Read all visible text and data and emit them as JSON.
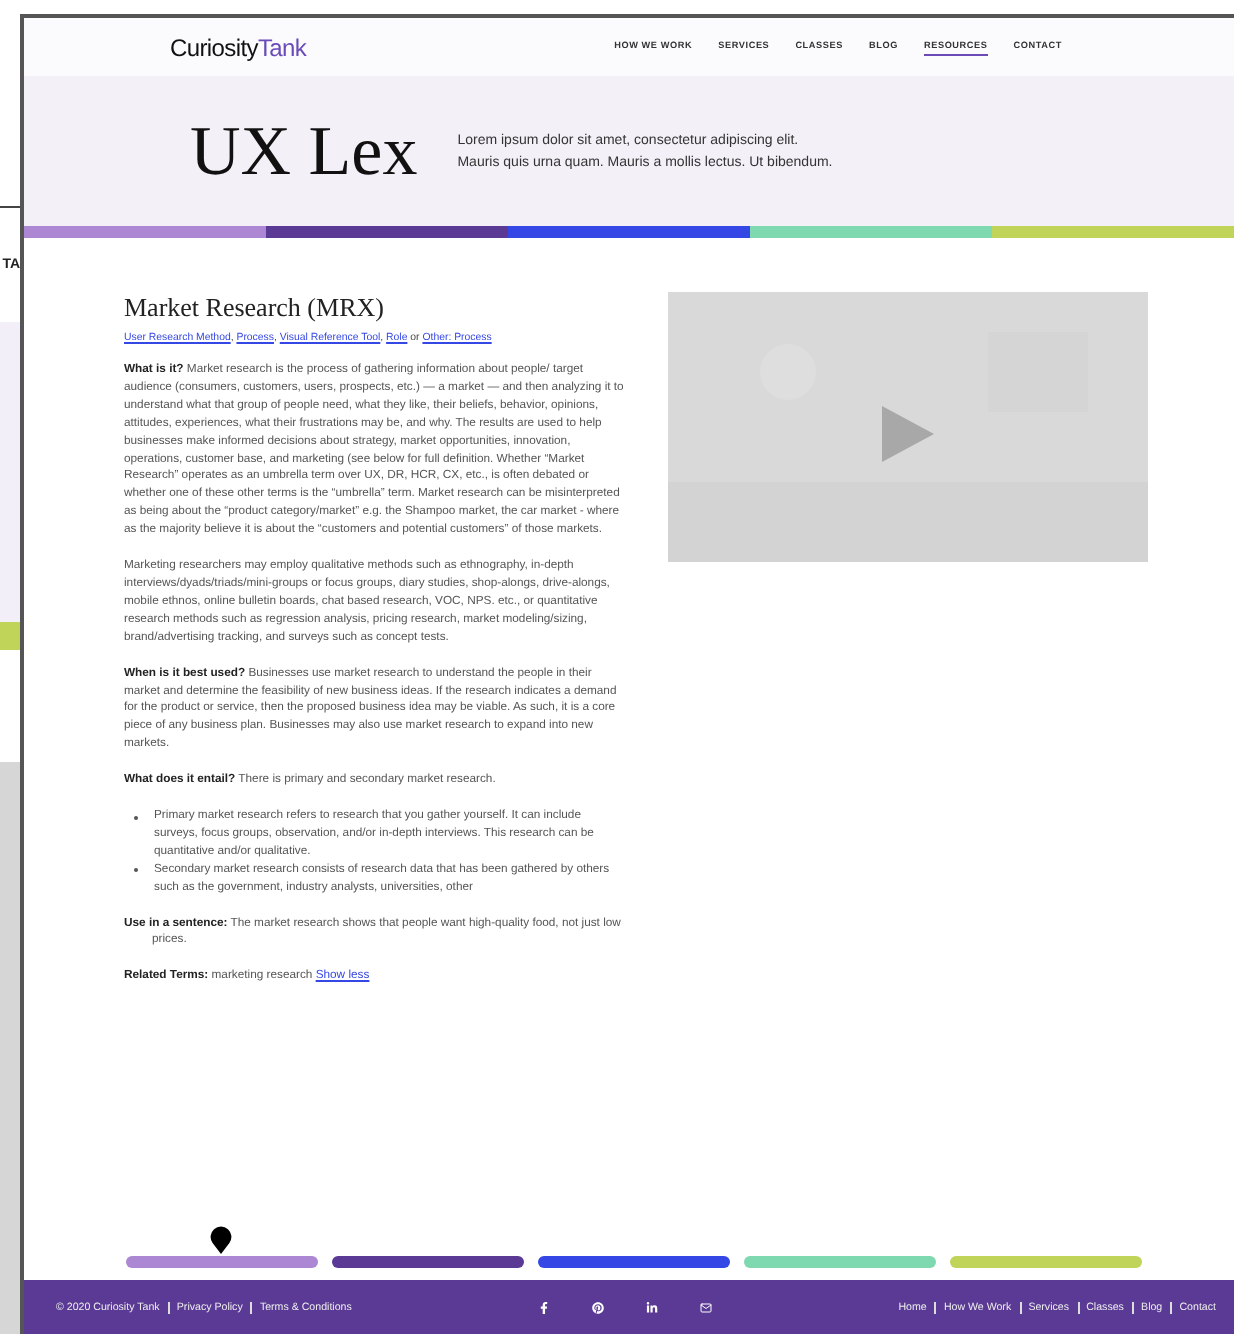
{
  "background_page": {
    "text": "TA"
  },
  "logo": {
    "text": "Curiosity",
    "accent": "Tank"
  },
  "nav": [
    {
      "label": "HOW WE WORK",
      "selected": false
    },
    {
      "label": "SERVICES",
      "selected": false
    },
    {
      "label": "CLASSES",
      "selected": false
    },
    {
      "label": "BLOG",
      "selected": false
    },
    {
      "label": "RESOURCES",
      "selected": true
    },
    {
      "label": "CONTACT",
      "selected": false
    }
  ],
  "hero": {
    "title": "UX Lex",
    "tagline": [
      "Lorem ipsum dolor sit amet, consectetur adipiscing elit.",
      "Mauris quis urna quam. Mauris a mollis lectus. Ut bibendum."
    ]
  },
  "color_bar": [
    {
      "color": "#ac87d4"
    },
    {
      "color": "#5a3a94"
    },
    {
      "color": "#3547e4"
    },
    {
      "color": "#7fd9b0"
    },
    {
      "color": "#c0d45a"
    }
  ],
  "term": {
    "title": "Market Research (MRX)",
    "categories": [
      {
        "label": "User Research Method",
        "after": ", "
      },
      {
        "label": "Process",
        "after": ", "
      },
      {
        "label": "Visual Reference Tool",
        "after": ", "
      },
      {
        "label": "Role",
        "after": " or "
      },
      {
        "label": "Other: Process"
      }
    ],
    "paragraphs": [
      "**What is it?** Market research is the process of gathering information about people/ target audience (consumers, customers, users, prospects, etc.) — a market — and then analyzing it to understand what that group of people need, what they like, their beliefs, behavior, opinions, attitudes, experiences, what their frustrations may be, and why. The results are used to help businesses make informed decisions about strategy, market opportunities, innovation, operations, customer base, and marketing (see below for full definition. Whether “Market Research” operates as an umbrella term over UX, DR, HCR, CX, etc., is often debated or whether one of these other terms is the “umbrella” term. Market research can be misinterpreted as being about the “product category/market” e.g. the Shampoo market, the car market - where as the majority believe it is about the “customers and potential customers” of those markets.",
      "Marketing researchers may employ qualitative methods such as ethnography, in-depth interviews/dyads/triads/mini-groups or focus groups, diary studies, shop-alongs, drive-alongs, mobile ethnos, online bulletin boards, chat based research, VOC, NPS. etc., or quantitative research methods such as regression analysis, pricing research, market modeling/sizing, brand/advertising tracking, and surveys such as concept tests.",
      "**When is it best used?** Businesses use market research to understand the people in their market and determine the feasibility of new business ideas. If the research indicates a demand for the product or service, then the proposed business idea may be viable. As such, it is a core piece of any business plan. Businesses may also use market research to expand into new markets.",
      "**What does it entail?** There is primary and secondary market research."
    ],
    "bullets": [
      "Primary market research refers to research that you gather yourself. It can include surveys, focus groups, observation, and/or in-depth interviews. This research can be quantitative and/or qualitative.",
      "Secondary market research consists of research data that has been gathered by others such as the government, industry analysts, universities, other"
    ],
    "sentence": "**Use in a sentence:** The market research shows that people want high-quality food, not just low prices.",
    "related": "**Related Terms:** marketing research",
    "show_less": "Show less"
  },
  "segments": [
    {
      "color": "#ac87d4",
      "selected": true
    },
    {
      "color": "#5a3a94",
      "selected": false
    },
    {
      "color": "#3547e4",
      "selected": false
    },
    {
      "color": "#7fd9b0",
      "selected": false
    },
    {
      "color": "#c0d45a",
      "selected": false
    }
  ],
  "footer": {
    "left": [
      "© 2020 Curiosity Tank",
      "Privacy Policy",
      "Terms & Conditions"
    ],
    "social": [
      {
        "kind": "facebook"
      },
      {
        "kind": "pinterest"
      },
      {
        "kind": "linkedin"
      },
      {
        "kind": "mail"
      }
    ],
    "right": [
      "Home",
      "How We Work",
      "Services",
      "Classes",
      "Blog",
      "Contact"
    ]
  }
}
